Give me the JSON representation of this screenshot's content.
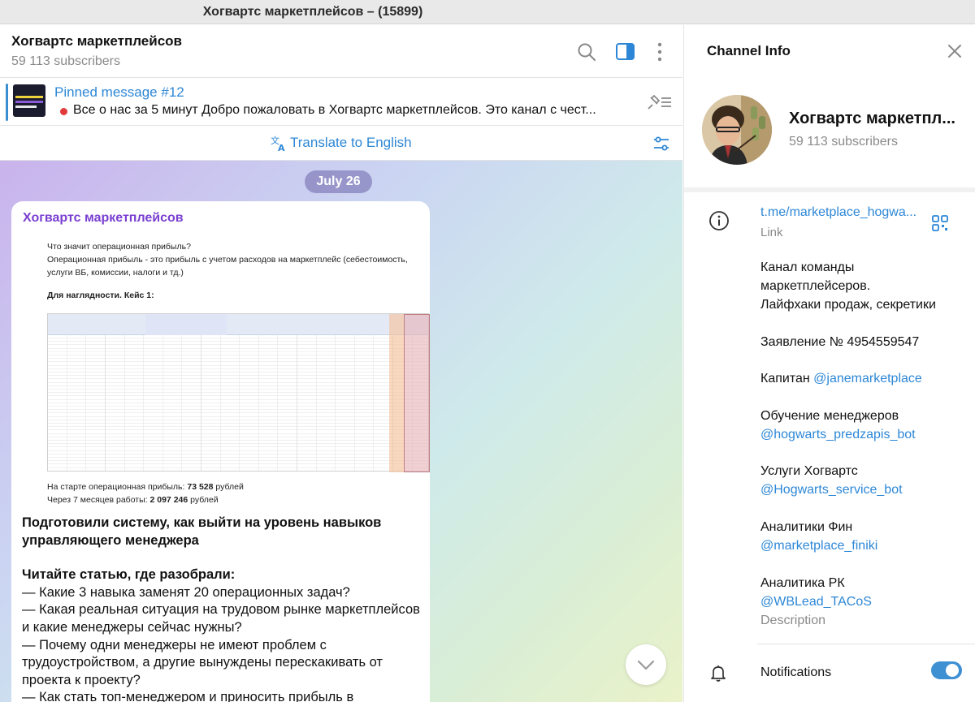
{
  "window": {
    "title": "Хогвартс маркетплейсов – (15899)"
  },
  "chat": {
    "name": "Хогвартс маркетплейсов",
    "subscribers": "59 113 subscribers",
    "icons": [
      "search-icon",
      "sidebar-toggle-icon",
      "more-vertical-icon"
    ],
    "pinned": {
      "title": "Pinned message #12",
      "text": "Все о нас за 5 минут  Добро пожаловать в Хогвартс маркетплейсов.  Это канал с чест..."
    },
    "translate_label": "Translate to English",
    "date": "July 26",
    "post": {
      "author": "Хогвартс маркетплейсов",
      "image": {
        "question": "Что значит операционная прибыль?",
        "definition": "Операционная прибыль - это прибыль с учетом расходов на маркетплейс (себестоимость, услуги ВБ, комиссии, налоги и тд.)",
        "case": "Для наглядности. Кейс 1:",
        "start_label": "На старте операционная прибыль: ",
        "start_value": "73 528",
        "start_unit": " рублей",
        "after_label": "Через 7 месяцев работы: ",
        "after_value": "2 097 246",
        "after_unit": " рублей"
      },
      "heading": "Подготовили систему, как выйти на уровень навыков управляющего менеджера",
      "read_heading": "Читайте статью, где разобрали:",
      "items": [
        "— Какие 3 навыка заменят 20 операционных задач?",
        "— Какая реальная ситуация на трудовом рынке маркетплейсов и какие менеджеры сейчас нужны?",
        "— Почему одни менеджеры не имеют проблем с трудоустройством, а другие вынуждены перескакивать от проекта к проекту?",
        "— Как стать топ-менеджером и приносить прибыль в"
      ]
    }
  },
  "info": {
    "header": "Channel Info",
    "name": "Хогвартс маркетпл...",
    "subscribers": "59 113 subscribers",
    "link": "t.me/marketplace_hogwa...",
    "link_label": "Link",
    "description_lines": [
      "Канал команды маркетплейсеров.",
      "Лайфхаки продаж, секретики"
    ],
    "statement": "Заявление № 4954559547",
    "captain_label": "Капитан ",
    "captain_handle": "@janemarketplace",
    "training_label": "Обучение менеджеров",
    "training_handle": "@hogwarts_predzapis_bot",
    "services_label": "Услуги Хогвартс",
    "services_handle": "@Hogwarts_service_bot",
    "fin_label": "Аналитики Фин",
    "fin_handle": "@marketplace_finiki",
    "rk_label": "Аналитика РК",
    "rk_handle": "@WBLead_TACoS",
    "description_label": "Description",
    "notifications_label": "Notifications",
    "notifications_on": true
  },
  "colors": {
    "accent": "#2d87d6",
    "author": "#7a3fd1",
    "toggle": "#3f90d2"
  }
}
